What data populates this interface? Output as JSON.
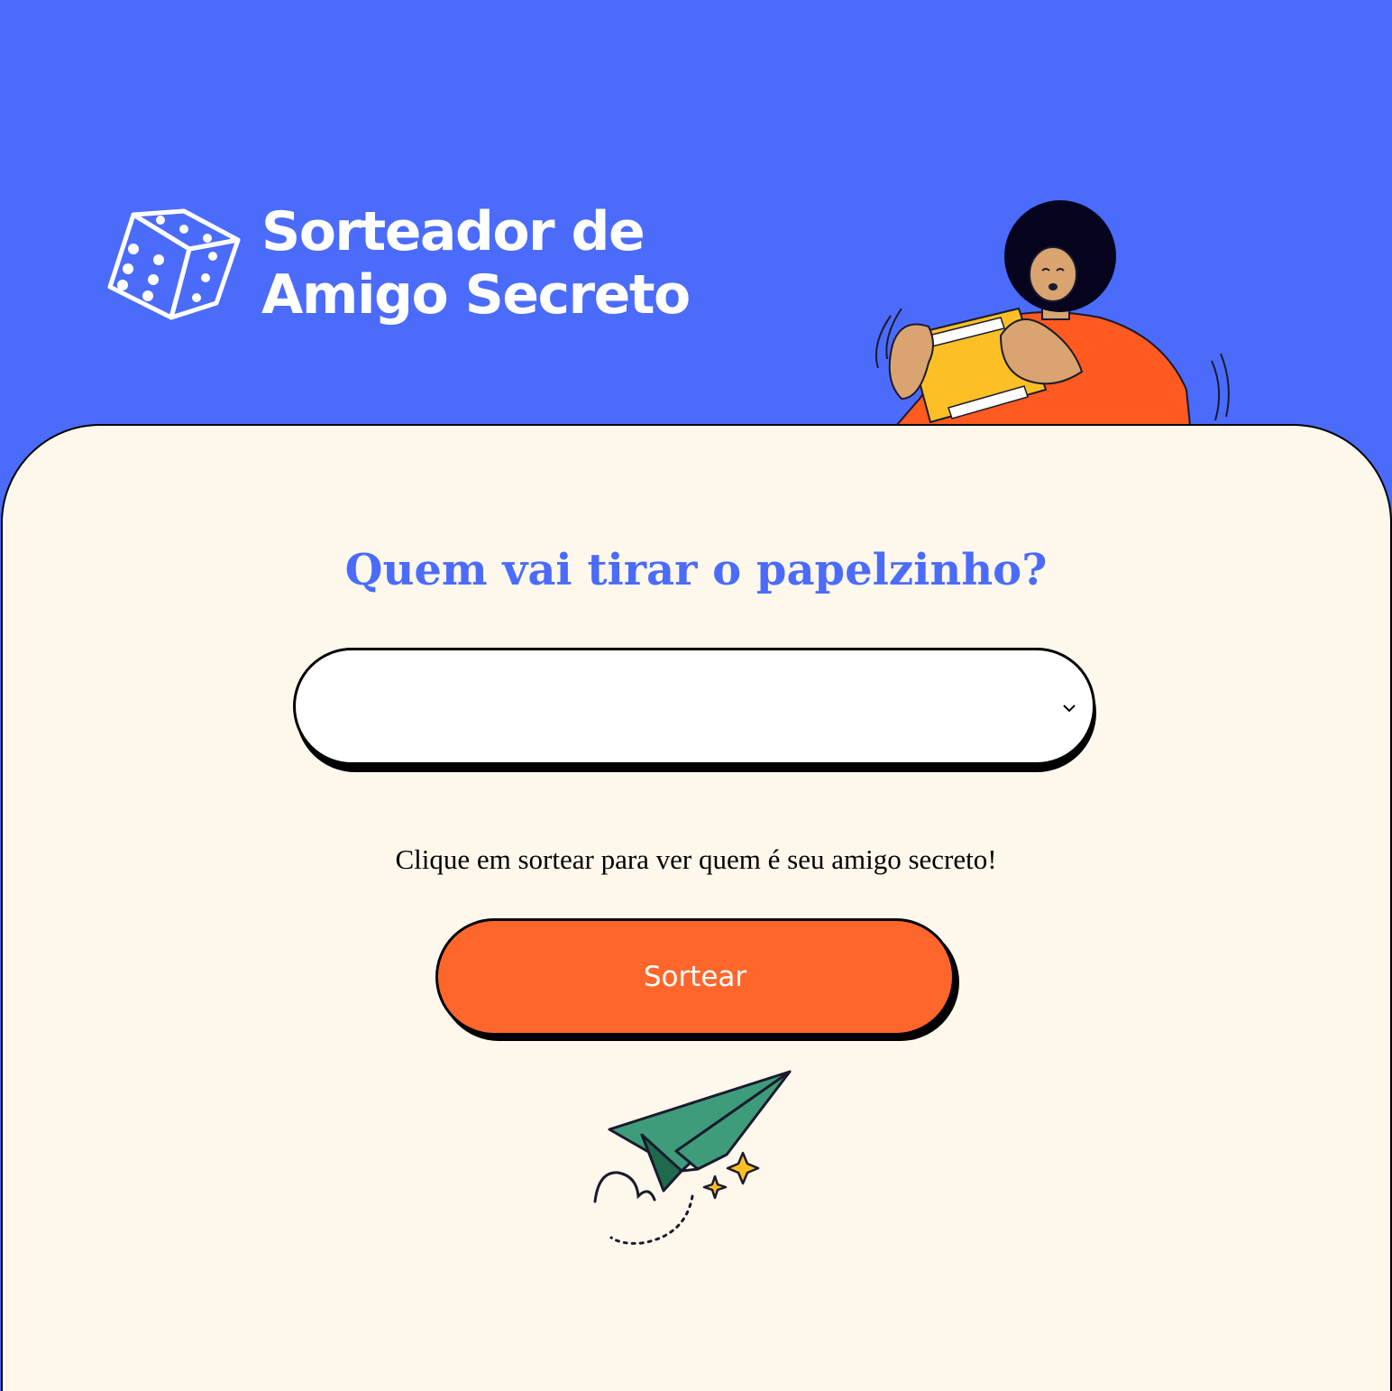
{
  "header": {
    "logo_line1": "Sorteador de",
    "logo_line2": "Amigo Secreto"
  },
  "main": {
    "title": "Quem vai tirar o papelzinho?",
    "select_value": "",
    "hint": "Clique em sortear para ver quem é seu amigo secreto!",
    "button_label": "Sortear"
  },
  "colors": {
    "background": "#4B6BFB",
    "card": "#FEF8EC",
    "button": "#FF662C",
    "title": "#4B6BFB"
  },
  "icons": {
    "logo": "dice-icon",
    "select_arrow": "chevron-down-icon",
    "hero": "person-with-gift-illustration",
    "footer": "paper-plane-illustration"
  }
}
